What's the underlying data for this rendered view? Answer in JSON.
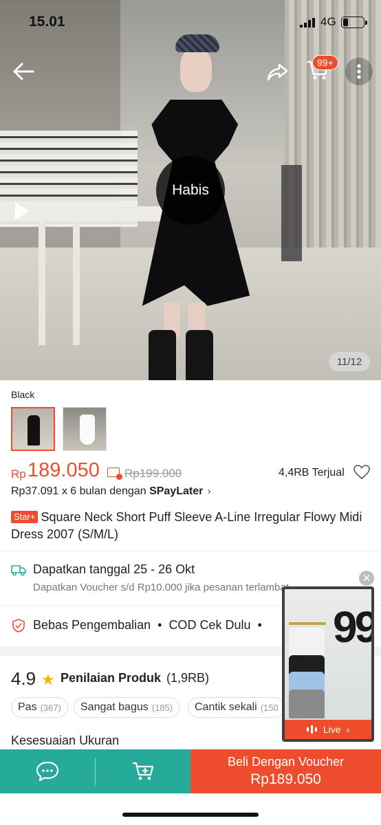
{
  "status_bar": {
    "time": "15.01",
    "network": "4G"
  },
  "header": {
    "cart_badge": "99+"
  },
  "media": {
    "soldout_label": "Habis",
    "image_counter": "11/12"
  },
  "variant": {
    "label": "Black"
  },
  "price": {
    "currency": "Rp",
    "value": "189.050",
    "original": "Rp199.000",
    "sold": "4,4RB Terjual"
  },
  "paylater": {
    "text": "Rp37.091 x 6 bulan dengan ",
    "brand": "SPayLater"
  },
  "product": {
    "badge": "Star+",
    "title": "Square Neck Short Puff Sleeve A-Line Irregular Flowy Midi Dress 2007 (S/M/L)"
  },
  "shipping": {
    "title": "Dapatkan tanggal 25 - 26 Okt",
    "subtitle": "Dapatkan Voucher s/d Rp10.000 jika pesanan terlambat"
  },
  "services": {
    "item1": "Bebas Pengembalian",
    "item2": "COD Cek Dulu"
  },
  "rating": {
    "value": "4.9",
    "title": "Penilaian Produk",
    "count": "(1,9RB)",
    "chips": [
      {
        "label": "Pas",
        "count": "(367)"
      },
      {
        "label": "Sangat bagus",
        "count": "(185)"
      },
      {
        "label": "Cantik sekali",
        "count": "(150"
      }
    ]
  },
  "size_fit": {
    "title": "Kesesuaian Ukuran"
  },
  "live": {
    "label": "Live",
    "overlay_number": "99"
  },
  "bottom_bar": {
    "buy_label": "Beli Dengan Voucher",
    "buy_price": "Rp189.050"
  },
  "colors": {
    "accent": "#ee4d2d",
    "teal": "#26aa99",
    "star": "#f6b10f"
  }
}
